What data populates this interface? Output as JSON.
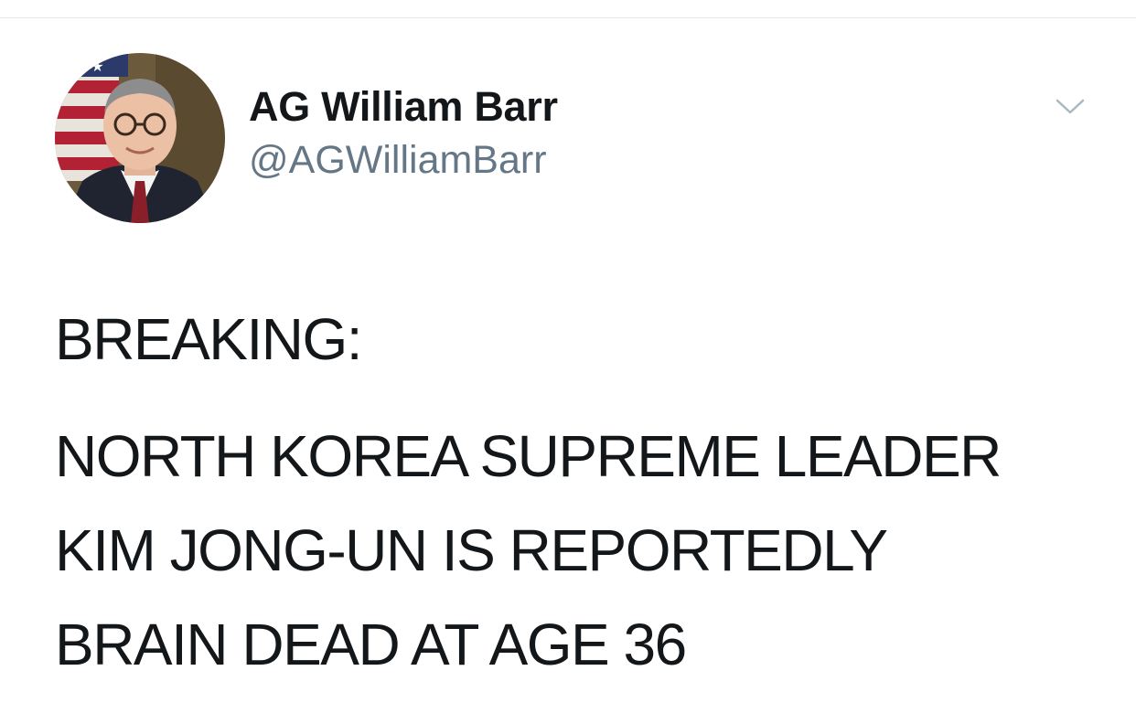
{
  "tweet": {
    "author": {
      "display_name": "AG William Barr",
      "handle": "@AGWilliamBarr"
    },
    "menu_icon": "chevron-down-icon",
    "body": {
      "lead": "BREAKING:",
      "lines": [
        "NORTH KOREA SUPREME LEADER",
        "KIM JONG-UN IS REPORTEDLY",
        "BRAIN DEAD AT AGE 36"
      ]
    }
  },
  "colors": {
    "text_primary": "#14171a",
    "text_secondary": "#657786",
    "divider": "#e1e8ed",
    "caret": "#aab8c2"
  }
}
